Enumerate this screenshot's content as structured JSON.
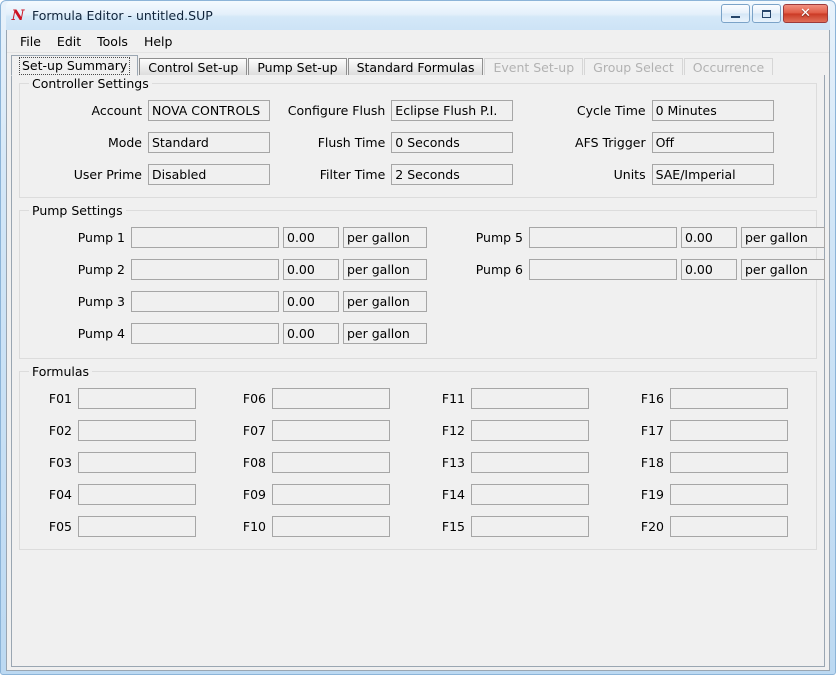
{
  "window": {
    "title": "Formula Editor - untitled.SUP",
    "icon": "nova-n-icon",
    "icon_glyph": "N",
    "buttons": {
      "minimize": "minimize",
      "maximize": "maximize",
      "close": "✕"
    },
    "frame_color": "#bcd9f2",
    "client_bg": "#f0f0f0"
  },
  "menubar": {
    "items": [
      {
        "label": "File"
      },
      {
        "label": "Edit"
      },
      {
        "label": "Tools"
      },
      {
        "label": "Help"
      }
    ]
  },
  "tabs": [
    {
      "label": "Set-up Summary",
      "active": true,
      "enabled": true
    },
    {
      "label": "Control Set-up",
      "active": false,
      "enabled": true
    },
    {
      "label": "Pump Set-up",
      "active": false,
      "enabled": true
    },
    {
      "label": "Standard Formulas",
      "active": false,
      "enabled": true
    },
    {
      "label": "Event Set-up",
      "active": false,
      "enabled": false
    },
    {
      "label": "Group Select",
      "active": false,
      "enabled": false
    },
    {
      "label": "Occurrence",
      "active": false,
      "enabled": false
    }
  ],
  "controller_settings": {
    "title": "Controller Settings",
    "column1": [
      {
        "label": "Account",
        "value": "NOVA CONTROLS"
      },
      {
        "label": "Mode",
        "value": "Standard"
      },
      {
        "label": "User Prime",
        "value": "Disabled"
      }
    ],
    "column2": [
      {
        "label": "Configure Flush",
        "value": "Eclipse Flush P.I."
      },
      {
        "label": "Flush Time",
        "value": "0 Seconds"
      },
      {
        "label": "Filter Time",
        "value": "2 Seconds"
      }
    ],
    "column3": [
      {
        "label": "Cycle Time",
        "value": "0 Minutes"
      },
      {
        "label": "AFS Trigger",
        "value": "Off"
      },
      {
        "label": "Units",
        "value": "SAE/Imperial"
      }
    ]
  },
  "pump_settings": {
    "title": "Pump Settings",
    "column1": [
      {
        "label": "Pump 1",
        "name": "",
        "rate": "0.00",
        "unit": "per gallon"
      },
      {
        "label": "Pump 2",
        "name": "",
        "rate": "0.00",
        "unit": "per gallon"
      },
      {
        "label": "Pump 3",
        "name": "",
        "rate": "0.00",
        "unit": "per gallon"
      },
      {
        "label": "Pump 4",
        "name": "",
        "rate": "0.00",
        "unit": "per gallon"
      }
    ],
    "column2": [
      {
        "label": "Pump 5",
        "name": "",
        "rate": "0.00",
        "unit": "per gallon"
      },
      {
        "label": "Pump 6",
        "name": "",
        "rate": "0.00",
        "unit": "per gallon"
      }
    ]
  },
  "formulas": {
    "title": "Formulas",
    "column1": [
      {
        "label": "F01",
        "value": ""
      },
      {
        "label": "F02",
        "value": ""
      },
      {
        "label": "F03",
        "value": ""
      },
      {
        "label": "F04",
        "value": ""
      },
      {
        "label": "F05",
        "value": ""
      }
    ],
    "column2": [
      {
        "label": "F06",
        "value": ""
      },
      {
        "label": "F07",
        "value": ""
      },
      {
        "label": "F08",
        "value": ""
      },
      {
        "label": "F09",
        "value": ""
      },
      {
        "label": "F10",
        "value": ""
      }
    ],
    "column3": [
      {
        "label": "F11",
        "value": ""
      },
      {
        "label": "F12",
        "value": ""
      },
      {
        "label": "F13",
        "value": ""
      },
      {
        "label": "F14",
        "value": ""
      },
      {
        "label": "F15",
        "value": ""
      }
    ],
    "column4": [
      {
        "label": "F16",
        "value": ""
      },
      {
        "label": "F17",
        "value": ""
      },
      {
        "label": "F18",
        "value": ""
      },
      {
        "label": "F19",
        "value": ""
      },
      {
        "label": "F20",
        "value": ""
      }
    ]
  }
}
